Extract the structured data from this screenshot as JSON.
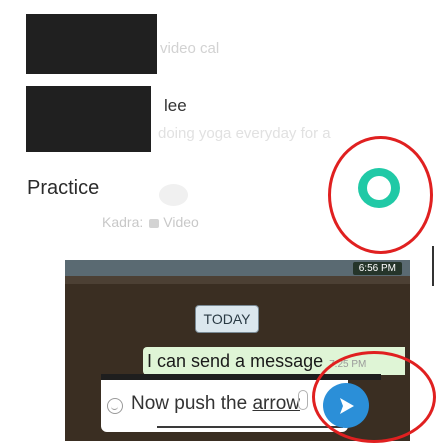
{
  "list": {
    "row1_faded": "video cal",
    "row2_name": "lee",
    "row2_faded": "doing yoga everyday for a",
    "group": {
      "title": "Practice",
      "sub_prefix": "Kadr",
      "sub_mid": "a:",
      "sub_rest": "Video"
    }
  },
  "chat": {
    "header_time": "6:56 PM",
    "date_chip": "TODAY",
    "message": "I can send a message",
    "message_time": "7:25 PM",
    "input_text_main": "Now push the ",
    "input_text_link": "arrow"
  },
  "colors": {
    "accent_green": "#20c9a6",
    "send_blue": "#2b8fd8",
    "highlight_red": "#e02020",
    "bubble_green": "#dff5d6"
  },
  "icons": [
    "smile-icon",
    "paperclip-icon",
    "send-arrow-icon"
  ]
}
